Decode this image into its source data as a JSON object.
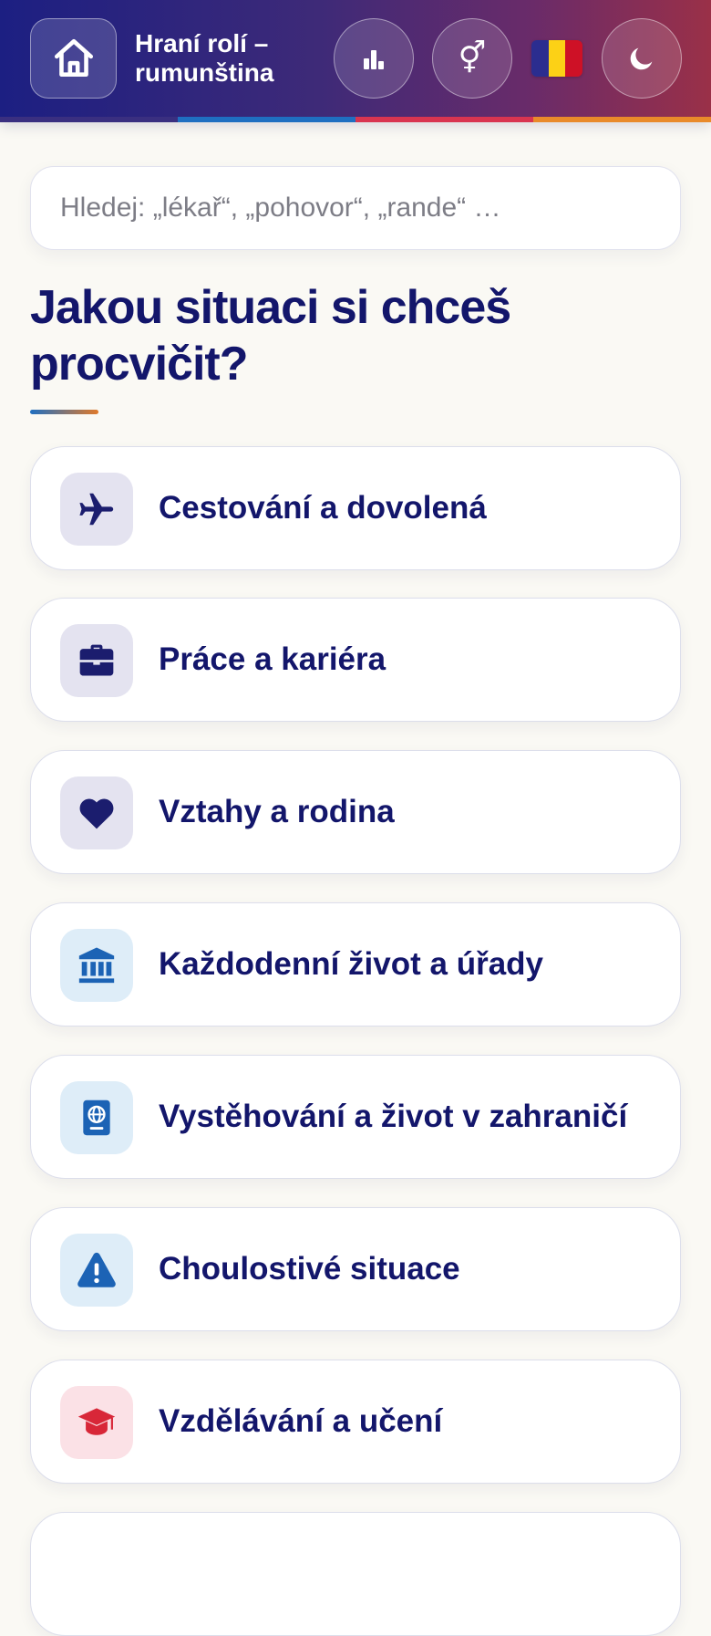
{
  "header": {
    "title": "Hraní rolí – rumunština",
    "home_icon": "home-icon",
    "stats_icon": "bar-chart-icon",
    "gender_icon": "gender-icon",
    "gender_glyph": "⚥",
    "flag_icon": "romania-flag-icon",
    "flag_colors": [
      "#2b2d8f",
      "#fcd116",
      "#ce1126"
    ],
    "theme_icon": "moon-icon",
    "stripe_colors": [
      "#3a2f80",
      "#1f6fc1",
      "#d93550",
      "#e98a2a"
    ]
  },
  "search": {
    "placeholder": "Hledej: „lékař“, „pohovor“, „rande“ …",
    "value": ""
  },
  "main": {
    "heading": "Jakou situaci si chceš procvičit?",
    "categories": [
      {
        "label": "Cestování a dovolená",
        "icon": "plane-icon",
        "icon_bg": "#e4e3f0",
        "icon_color": "#1b1d6e"
      },
      {
        "label": "Práce a kariéra",
        "icon": "briefcase-icon",
        "icon_bg": "#e4e3f0",
        "icon_color": "#1b1d6e"
      },
      {
        "label": "Vztahy a rodina",
        "icon": "heart-icon",
        "icon_bg": "#e4e3f0",
        "icon_color": "#1b1d6e"
      },
      {
        "label": "Každodenní život a úřady",
        "icon": "bank-icon",
        "icon_bg": "#deedf8",
        "icon_color": "#1c63b5"
      },
      {
        "label": "Vystěhování a život v zahraničí",
        "icon": "passport-icon",
        "icon_bg": "#deedf8",
        "icon_color": "#1c63b5"
      },
      {
        "label": "Choulostivé situace",
        "icon": "warning-icon",
        "icon_bg": "#deedf8",
        "icon_color": "#1c63b5"
      },
      {
        "label": "Vzdělávání a učení",
        "icon": "graduation-cap-icon",
        "icon_bg": "#fbe1e6",
        "icon_color": "#d82738"
      }
    ]
  }
}
